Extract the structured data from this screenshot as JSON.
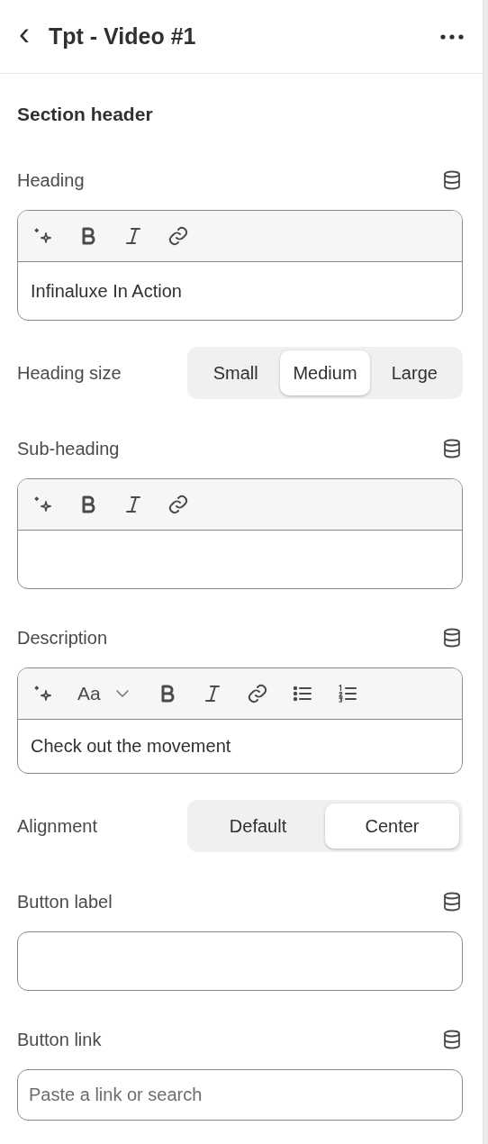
{
  "header": {
    "back": "‹",
    "title": "Tpt - Video #1"
  },
  "section_title": "Section header",
  "fields": [
    {
      "kind": "richtext",
      "label": "Heading",
      "dynamic_source": true,
      "tools": [
        {
          "kind": "sparkle"
        },
        {
          "kind": "bold"
        },
        {
          "kind": "italic"
        },
        {
          "kind": "link"
        }
      ],
      "value": "Infinaluxe In Action"
    },
    {
      "kind": "segmented",
      "label": "Heading size",
      "options": [
        {
          "label": "Small",
          "selected": false
        },
        {
          "label": "Medium",
          "selected": true
        },
        {
          "label": "Large",
          "selected": false
        }
      ]
    },
    {
      "kind": "richtext",
      "label": "Sub-heading",
      "dynamic_source": true,
      "tools": [
        {
          "kind": "sparkle"
        },
        {
          "kind": "bold"
        },
        {
          "kind": "italic"
        },
        {
          "kind": "link"
        }
      ]
    },
    {
      "kind": "richtext",
      "label": "Description",
      "dynamic_source": true,
      "tools": [
        {
          "kind": "sparkle"
        },
        {
          "kind": "font",
          "label": "Aa"
        },
        {
          "kind": "bold"
        },
        {
          "kind": "italic"
        },
        {
          "kind": "link"
        },
        {
          "kind": "bullets"
        },
        {
          "kind": "numbered"
        }
      ],
      "value": "Check out the movement"
    },
    {
      "kind": "segmented",
      "label": "Alignment",
      "options": [
        {
          "label": "Default",
          "selected": false
        },
        {
          "label": "Center",
          "selected": true
        }
      ]
    },
    {
      "kind": "text",
      "label": "Button label",
      "dynamic_source": true
    },
    {
      "kind": "link",
      "label": "Button link",
      "dynamic_source": true,
      "placeholder": "Paste a link or search"
    }
  ]
}
